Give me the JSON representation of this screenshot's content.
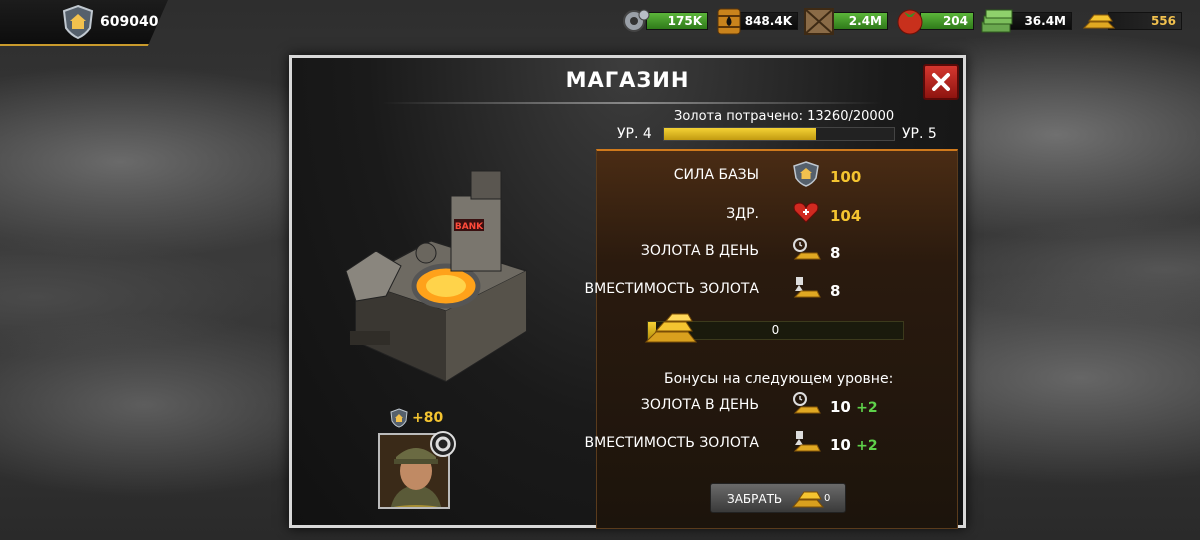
{
  "topbar": {
    "power": "609040",
    "resources": [
      {
        "name": "parts",
        "icon": "gear-parts-icon",
        "value": "175K"
      },
      {
        "name": "oil",
        "icon": "oil-barrel-icon",
        "value": "848.4K"
      },
      {
        "name": "supplies",
        "icon": "crate-icon",
        "value": "2.4M"
      },
      {
        "name": "food",
        "icon": "tomato-icon",
        "value": "204"
      },
      {
        "name": "cash",
        "icon": "cash-stack-icon",
        "value": "36.4M"
      },
      {
        "name": "gold",
        "icon": "gold-bars-icon",
        "value": "556"
      }
    ]
  },
  "modal": {
    "title": "МАГАЗИН",
    "gold_spent_text": "Золота потрачено: 13260/20000",
    "level_from": "УР. 4",
    "level_to": "УР. 5",
    "level_progress": 0.663,
    "stats": {
      "base_power_label": "СИЛА БАЗЫ",
      "base_power_value": "100",
      "health_label": "ЗДР.",
      "health_value": "104",
      "gold_per_day_label": "ЗОЛОТА В ДЕНЬ",
      "gold_per_day_value": "8",
      "gold_capacity_label": "ВМЕСТИМОСТЬ ЗОЛОТА",
      "gold_capacity_value": "8"
    },
    "gold_storage_value": "0",
    "gold_storage_fill": 0.03,
    "next_level": {
      "heading": "Бонусы на следующем уровне:",
      "gold_per_day_label": "ЗОЛОТА В ДЕНЬ",
      "gold_per_day_value": "10",
      "gold_per_day_bonus": "+2",
      "gold_capacity_label": "ВМЕСТИМОСТЬ ЗОЛОТА",
      "gold_capacity_value": "10",
      "gold_capacity_bonus": "+2"
    },
    "collect_label": "ЗАБРАТЬ",
    "collect_amount": "0",
    "commander_bonus": "+80",
    "building_sign": "BANK"
  },
  "colors": {
    "accent_gold": "#f4c430",
    "bonus_green": "#5ed14a",
    "close_red": "#d4372f",
    "resource_green": "#5bb53a"
  }
}
